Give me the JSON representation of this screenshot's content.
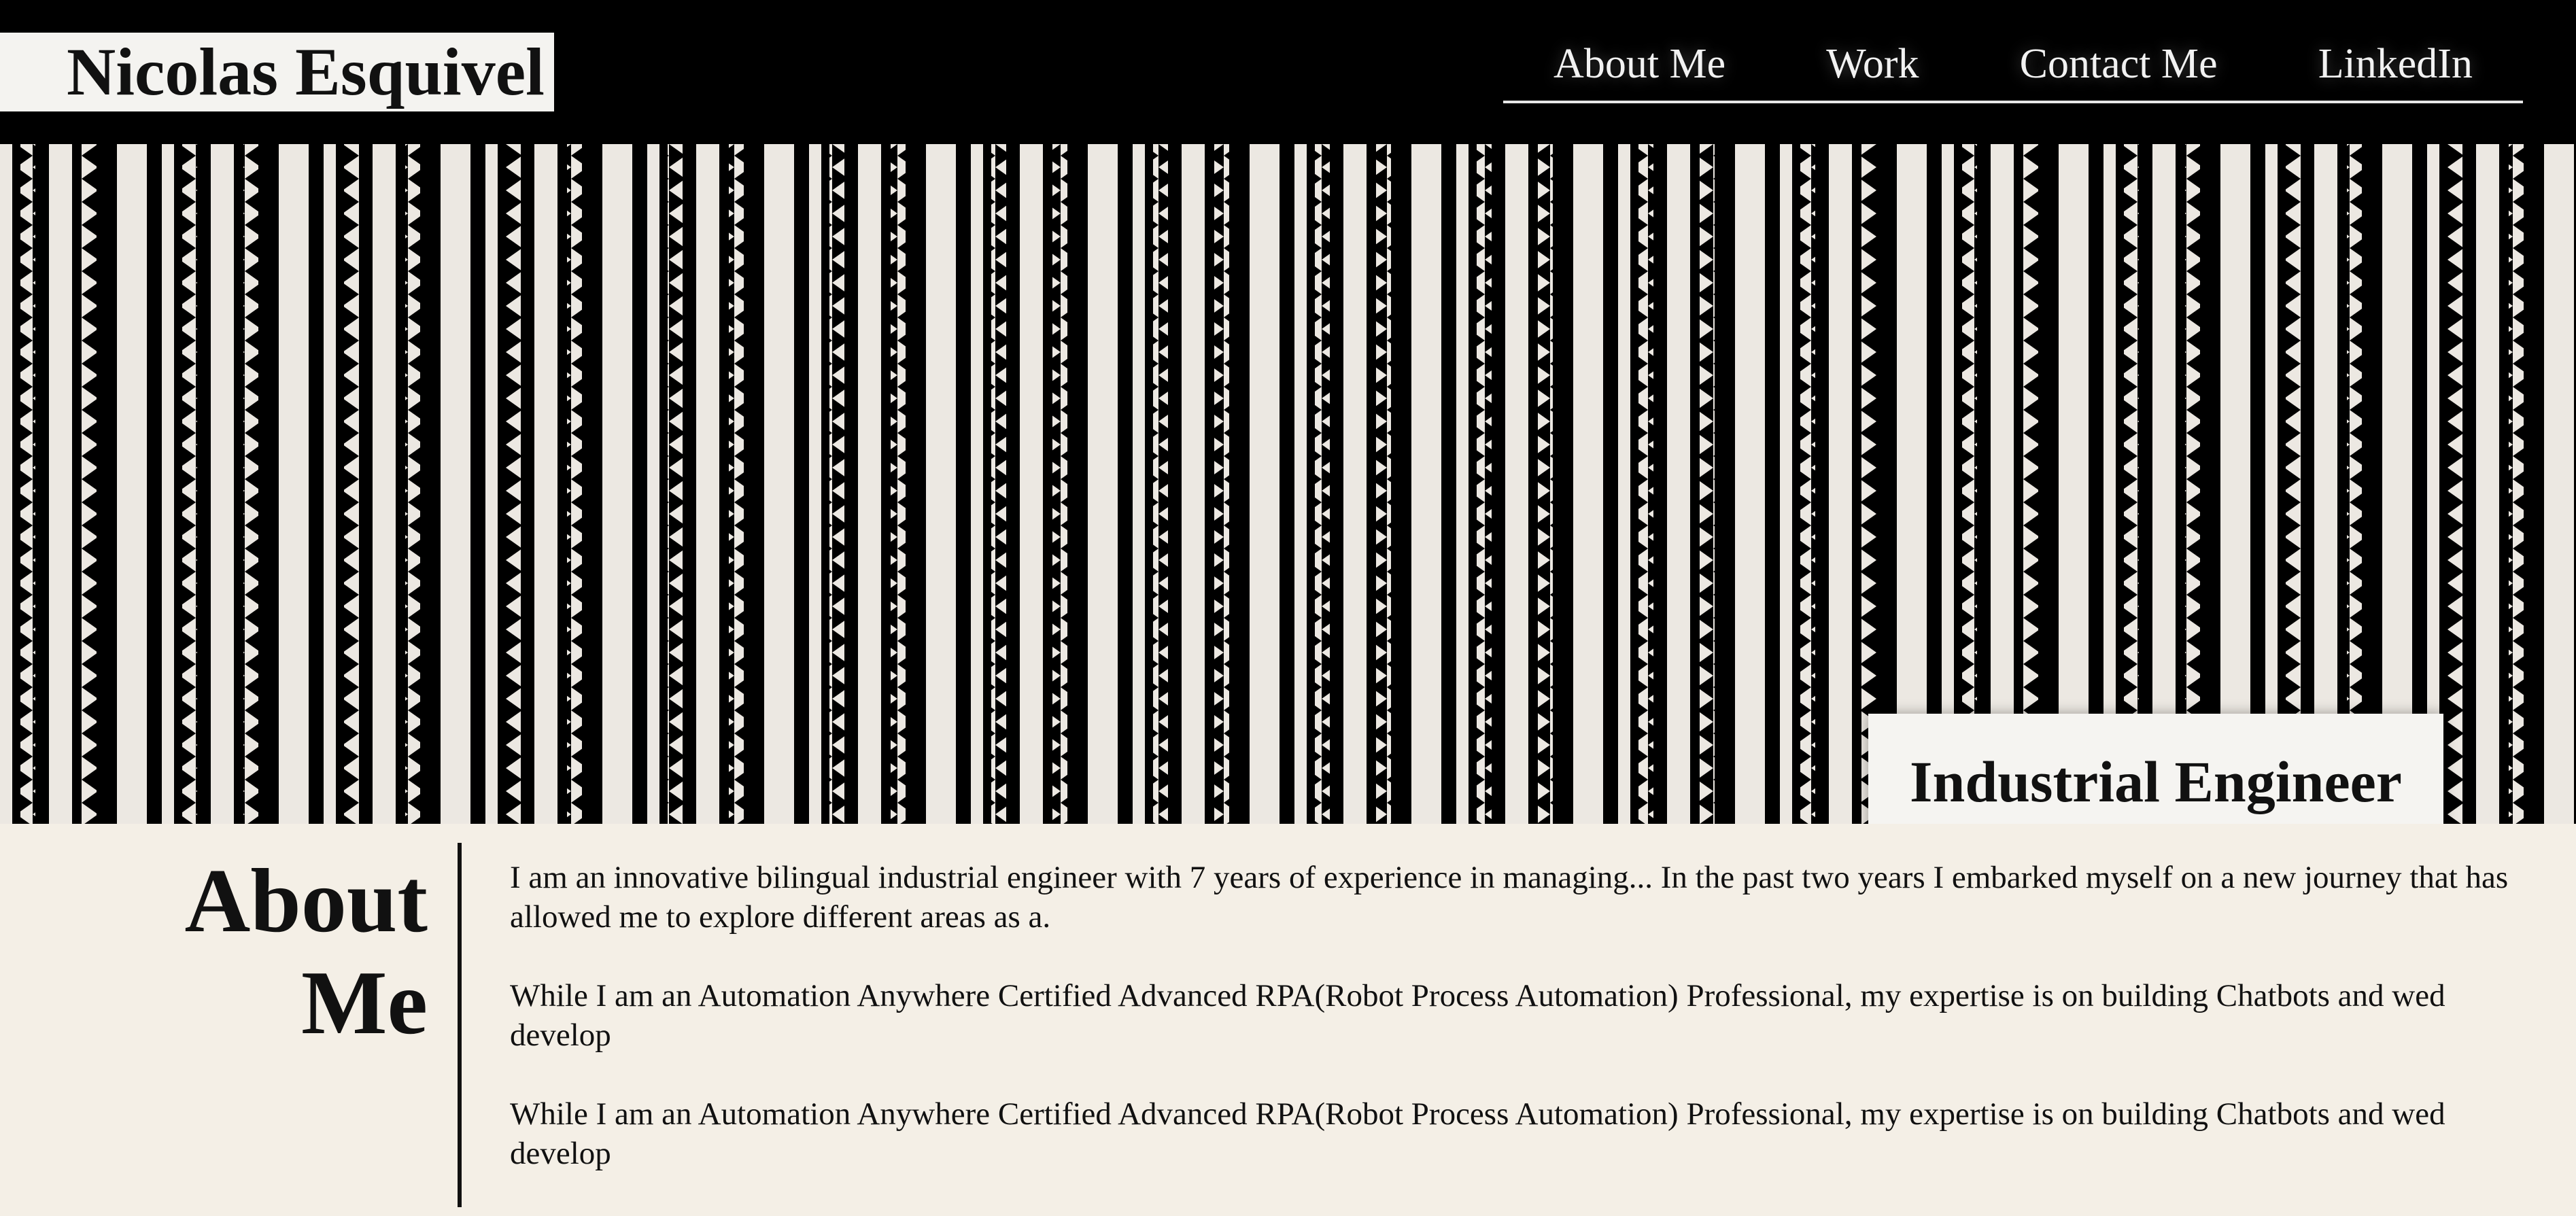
{
  "header": {
    "brand": "Nicolas Esquivel",
    "nav": [
      {
        "label": "About Me"
      },
      {
        "label": "Work"
      },
      {
        "label": "Contact Me"
      },
      {
        "label": "LinkedIn"
      }
    ]
  },
  "hero": {
    "tagline": "Industrial Engineer",
    "pattern": "black-and-white striped tribal pattern"
  },
  "about": {
    "heading_line1": "About",
    "heading_line2": "Me",
    "paragraphs": [
      "I am an innovative bilingual industrial engineer with 7 years of experience in managing... In the past two years I embarked myself on a new journey that has allowed me to explore different areas as a.",
      "While I am an Automation Anywhere Certified Advanced RPA(Robot Process Automation) Professional, my expertise is on building Chatbots and wed develop",
      "While I am an Automation Anywhere Certified Advanced RPA(Robot Process Automation) Professional, my expertise is on building Chatbots and wed develop"
    ]
  },
  "colors": {
    "background_dark": "#000000",
    "about_background": "#f4efe6",
    "stripe_light": "#ece8e2",
    "text_dark": "#111111",
    "nav_text": "#f2f2f2"
  }
}
